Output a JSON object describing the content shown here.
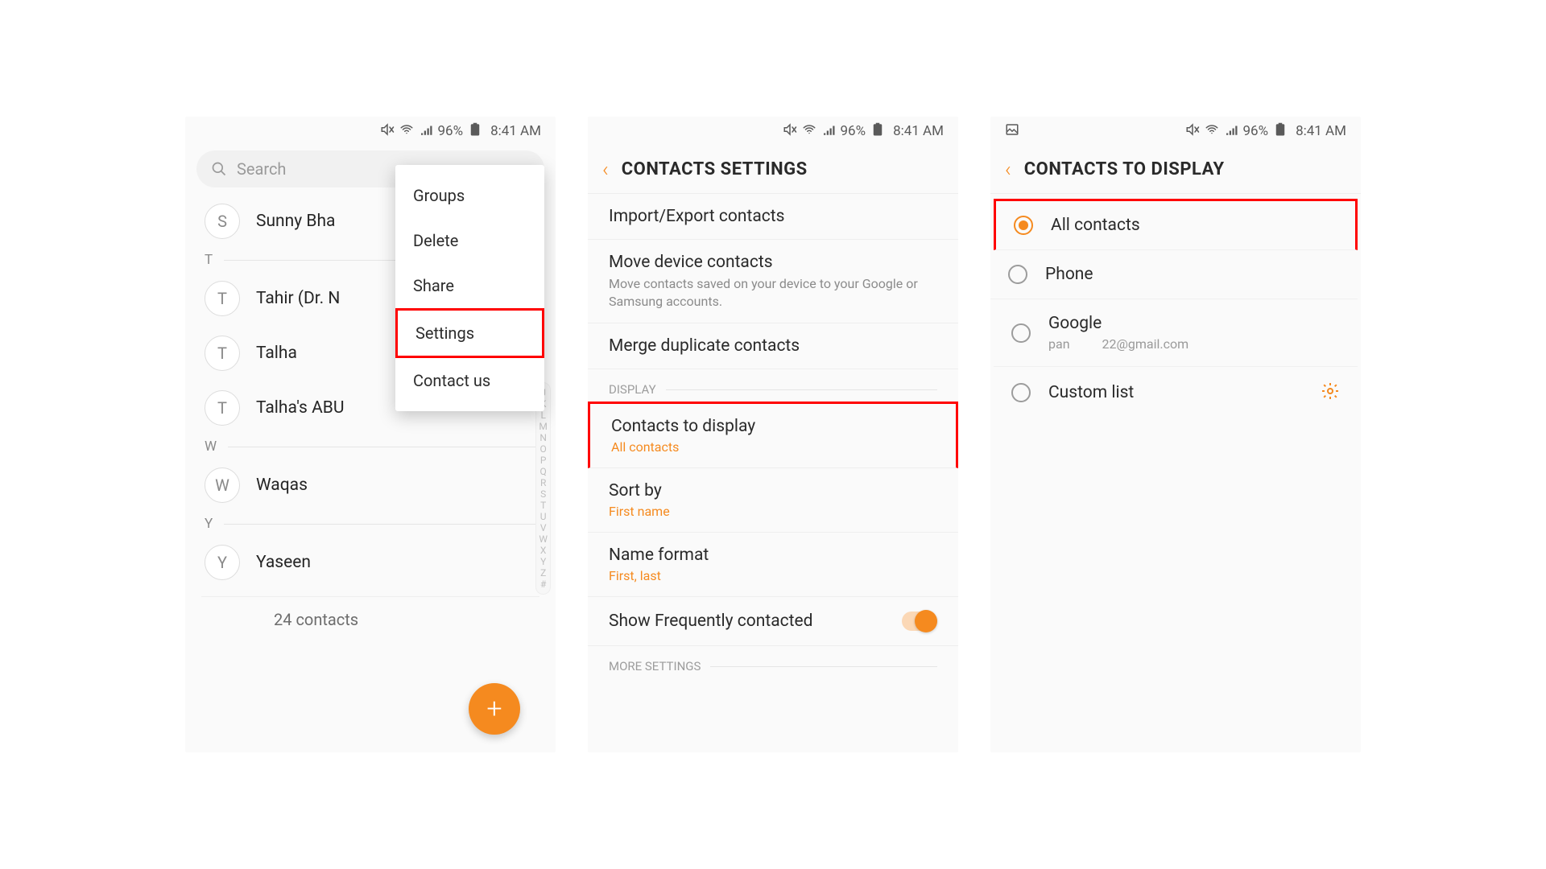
{
  "status": {
    "battery": "96%",
    "time": "8:41 AM"
  },
  "screen1": {
    "search_placeholder": "Search",
    "contacts": [
      {
        "letter": "S",
        "name": "Sunny Bha"
      },
      {
        "section": "T"
      },
      {
        "letter": "T",
        "name": "Tahir (Dr. N"
      },
      {
        "letter": "T",
        "name": "Talha"
      },
      {
        "letter": "T",
        "name": "Talha's ABU"
      },
      {
        "section": "W"
      },
      {
        "letter": "W",
        "name": "Waqas"
      },
      {
        "section": "Y"
      },
      {
        "letter": "Y",
        "name": "Yaseen"
      }
    ],
    "count_label": "24 contacts",
    "menu": {
      "groups": "Groups",
      "delete": "Delete",
      "share": "Share",
      "settings": "Settings",
      "contactus": "Contact us"
    },
    "index": [
      "J",
      "K",
      "L",
      "M",
      "N",
      "O",
      "P",
      "Q",
      "R",
      "S",
      "T",
      "U",
      "V",
      "W",
      "X",
      "Y",
      "Z",
      "#"
    ]
  },
  "screen2": {
    "title": "CONTACTS SETTINGS",
    "import_export": "Import/Export contacts",
    "move_title": "Move device contacts",
    "move_sub": "Move contacts saved on your device to your Google or Samsung accounts.",
    "merge": "Merge duplicate contacts",
    "section_display": "DISPLAY",
    "cd_title": "Contacts to display",
    "cd_val": "All contacts",
    "sort_title": "Sort by",
    "sort_val": "First name",
    "name_title": "Name format",
    "name_val": "First, last",
    "freq_title": "Show Frequently contacted",
    "section_more": "MORE SETTINGS"
  },
  "screen3": {
    "title": "CONTACTS TO DISPLAY",
    "all": "All contacts",
    "phone": "Phone",
    "google": "Google",
    "google_acct_a": "pan",
    "google_acct_b": "22@gmail.com",
    "custom": "Custom list"
  }
}
